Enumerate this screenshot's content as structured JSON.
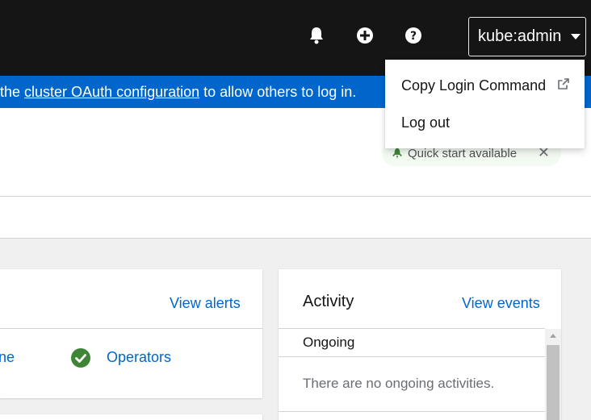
{
  "masthead": {
    "user_label": "kube:admin",
    "icons": [
      "bell-icon",
      "plus-circle-icon",
      "question-circle-icon"
    ]
  },
  "banner": {
    "prefix": "the ",
    "link": "cluster OAuth configuration",
    "suffix": " to allow others to log in."
  },
  "quickstart": {
    "label": "Quick start available"
  },
  "status_card": {
    "view_alerts": "View alerts",
    "row_partial": "ne",
    "operators": "Operators"
  },
  "activity": {
    "title": "Activity",
    "view_events": "View events",
    "ongoing_heading": "Ongoing",
    "no_ongoing": "There are no ongoing activities."
  },
  "user_menu": {
    "items": [
      {
        "label": "Copy Login Command"
      },
      {
        "label": "Log out"
      }
    ]
  },
  "colors": {
    "masthead": "#151515",
    "banner": "#0066cc",
    "link": "#0066cc",
    "success": "#3e8635"
  }
}
